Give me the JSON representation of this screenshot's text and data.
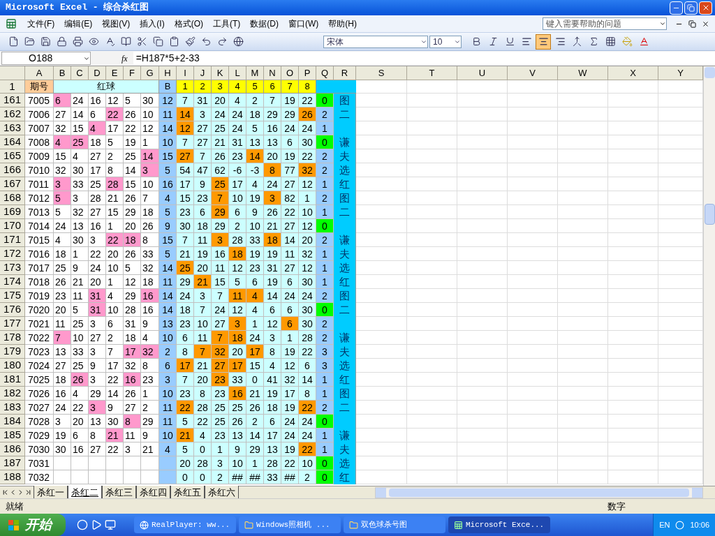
{
  "window": {
    "title": "Microsoft Excel - 综合杀红图"
  },
  "menu": [
    "文件(F)",
    "编辑(E)",
    "视图(V)",
    "插入(I)",
    "格式(O)",
    "工具(T)",
    "数据(D)",
    "窗口(W)",
    "帮助(H)"
  ],
  "help_search": {
    "placeholder": "键入需要帮助的问题"
  },
  "format_toolbar": {
    "font": "宋体",
    "size": "10",
    "align_buttons": [
      {
        "kind": "left",
        "selected": false
      },
      {
        "kind": "center",
        "selected": true
      },
      {
        "kind": "right",
        "selected": false
      }
    ]
  },
  "formula_bar": {
    "name_box": "O188",
    "function_label": "fx",
    "formula": "=H187*5+2-33"
  },
  "columns": [
    "A",
    "B",
    "C",
    "D",
    "E",
    "F",
    "G",
    "H",
    "I",
    "J",
    "K",
    "L",
    "M",
    "N",
    "O",
    "P",
    "Q",
    "R",
    "S",
    "T",
    "U",
    "V",
    "W",
    "X",
    "Y"
  ],
  "header_row": {
    "number": "1",
    "period": "期号",
    "red": "红球",
    "blue": "B",
    "positions": [
      "1",
      "2",
      "3",
      "4",
      "5",
      "6",
      "7",
      "8"
    ]
  },
  "rows": [
    {
      "n": "161",
      "id": "7005",
      "reds": [
        {
          "v": "6",
          "hl": true
        },
        {
          "v": "24",
          "hl": false
        },
        {
          "v": "16",
          "hl": false
        },
        {
          "v": "12",
          "hl": false
        },
        {
          "v": "5",
          "hl": false
        },
        {
          "v": "30",
          "hl": false
        }
      ],
      "blue": "12",
      "kills": [
        {
          "v": "7",
          "hl": false
        },
        {
          "v": "31",
          "hl": false
        },
        {
          "v": "20",
          "hl": false
        },
        {
          "v": "4",
          "hl": false
        },
        {
          "v": "2",
          "hl": false
        },
        {
          "v": "7",
          "hl": false
        },
        {
          "v": "19",
          "hl": false
        },
        {
          "v": "22",
          "hl": false
        }
      ],
      "q": {
        "v": "0",
        "green": true
      },
      "r": "图"
    },
    {
      "n": "162",
      "id": "7006",
      "reds": [
        {
          "v": "27",
          "hl": false
        },
        {
          "v": "14",
          "hl": false
        },
        {
          "v": "6",
          "hl": false
        },
        {
          "v": "22",
          "hl": true
        },
        {
          "v": "26",
          "hl": false
        },
        {
          "v": "10",
          "hl": false
        }
      ],
      "blue": "11",
      "kills": [
        {
          "v": "14",
          "hl": true
        },
        {
          "v": "3",
          "hl": false
        },
        {
          "v": "24",
          "hl": false
        },
        {
          "v": "24",
          "hl": false
        },
        {
          "v": "18",
          "hl": false
        },
        {
          "v": "29",
          "hl": false
        },
        {
          "v": "29",
          "hl": false
        },
        {
          "v": "26",
          "hl": true
        }
      ],
      "q": {
        "v": "2",
        "green": false
      },
      "r": "二"
    },
    {
      "n": "163",
      "id": "7007",
      "reds": [
        {
          "v": "32",
          "hl": false
        },
        {
          "v": "15",
          "hl": false
        },
        {
          "v": "4",
          "hl": true
        },
        {
          "v": "17",
          "hl": false
        },
        {
          "v": "22",
          "hl": false
        },
        {
          "v": "12",
          "hl": false
        }
      ],
      "blue": "14",
      "kills": [
        {
          "v": "12",
          "hl": true
        },
        {
          "v": "27",
          "hl": false
        },
        {
          "v": "25",
          "hl": false
        },
        {
          "v": "24",
          "hl": false
        },
        {
          "v": "5",
          "hl": false
        },
        {
          "v": "16",
          "hl": false
        },
        {
          "v": "24",
          "hl": false
        },
        {
          "v": "24",
          "hl": false
        }
      ],
      "q": {
        "v": "1",
        "green": false
      }
    },
    {
      "n": "164",
      "id": "7008",
      "reds": [
        {
          "v": "4",
          "hl": true
        },
        {
          "v": "25",
          "hl": true
        },
        {
          "v": "18",
          "hl": false
        },
        {
          "v": "5",
          "hl": false
        },
        {
          "v": "19",
          "hl": false
        },
        {
          "v": "1",
          "hl": false
        }
      ],
      "blue": "10",
      "kills": [
        {
          "v": "7",
          "hl": false
        },
        {
          "v": "27",
          "hl": false
        },
        {
          "v": "21",
          "hl": false
        },
        {
          "v": "31",
          "hl": false
        },
        {
          "v": "13",
          "hl": false
        },
        {
          "v": "13",
          "hl": false
        },
        {
          "v": "6",
          "hl": false
        },
        {
          "v": "30",
          "hl": false
        }
      ],
      "q": {
        "v": "0",
        "green": true
      },
      "r": "谦"
    },
    {
      "n": "165",
      "id": "7009",
      "reds": [
        {
          "v": "15",
          "hl": false
        },
        {
          "v": "4",
          "hl": false
        },
        {
          "v": "27",
          "hl": false
        },
        {
          "v": "2",
          "hl": false
        },
        {
          "v": "25",
          "hl": false
        },
        {
          "v": "14",
          "hl": true
        }
      ],
      "blue": "15",
      "kills": [
        {
          "v": "27",
          "hl": true
        },
        {
          "v": "7",
          "hl": false
        },
        {
          "v": "26",
          "hl": false
        },
        {
          "v": "23",
          "hl": false
        },
        {
          "v": "14",
          "hl": true
        },
        {
          "v": "20",
          "hl": false
        },
        {
          "v": "19",
          "hl": false
        },
        {
          "v": "22",
          "hl": false
        }
      ],
      "q": {
        "v": "2",
        "green": false
      },
      "r": "夫"
    },
    {
      "n": "166",
      "id": "7010",
      "reds": [
        {
          "v": "32",
          "hl": false
        },
        {
          "v": "30",
          "hl": false
        },
        {
          "v": "17",
          "hl": false
        },
        {
          "v": "8",
          "hl": false
        },
        {
          "v": "14",
          "hl": false
        },
        {
          "v": "3",
          "hl": true
        }
      ],
      "blue": "5",
      "kills": [
        {
          "v": "54",
          "hl": false
        },
        {
          "v": "47",
          "hl": false
        },
        {
          "v": "62",
          "hl": false
        },
        {
          "v": "-6",
          "hl": false
        },
        {
          "v": "-3",
          "hl": false
        },
        {
          "v": "8",
          "hl": true
        },
        {
          "v": "77",
          "hl": false
        },
        {
          "v": "32",
          "hl": true
        }
      ],
      "q": {
        "v": "2",
        "green": false
      },
      "r": "选"
    },
    {
      "n": "167",
      "id": "7011",
      "reds": [
        {
          "v": "3",
          "hl": true
        },
        {
          "v": "33",
          "hl": false
        },
        {
          "v": "25",
          "hl": false
        },
        {
          "v": "28",
          "hl": true
        },
        {
          "v": "15",
          "hl": false
        },
        {
          "v": "10",
          "hl": false
        }
      ],
      "blue": "16",
      "kills": [
        {
          "v": "17",
          "hl": false
        },
        {
          "v": "9",
          "hl": false
        },
        {
          "v": "25",
          "hl": true
        },
        {
          "v": "17",
          "hl": false
        },
        {
          "v": "4",
          "hl": false
        },
        {
          "v": "24",
          "hl": false
        },
        {
          "v": "27",
          "hl": false
        },
        {
          "v": "12",
          "hl": false
        }
      ],
      "q": {
        "v": "1",
        "green": false
      },
      "r": "红"
    },
    {
      "n": "168",
      "id": "7012",
      "reds": [
        {
          "v": "5",
          "hl": true
        },
        {
          "v": "3",
          "hl": false
        },
        {
          "v": "28",
          "hl": false
        },
        {
          "v": "21",
          "hl": false
        },
        {
          "v": "26",
          "hl": false
        },
        {
          "v": "7",
          "hl": false
        }
      ],
      "blue": "4",
      "kills": [
        {
          "v": "15",
          "hl": false
        },
        {
          "v": "23",
          "hl": false
        },
        {
          "v": "7",
          "hl": true
        },
        {
          "v": "10",
          "hl": false
        },
        {
          "v": "19",
          "hl": false
        },
        {
          "v": "3",
          "hl": true
        },
        {
          "v": "82",
          "hl": false
        },
        {
          "v": "1",
          "hl": false
        }
      ],
      "q": {
        "v": "2",
        "green": false
      },
      "r": "图"
    },
    {
      "n": "169",
      "id": "7013",
      "reds": [
        {
          "v": "5",
          "hl": false
        },
        {
          "v": "32",
          "hl": false
        },
        {
          "v": "27",
          "hl": false
        },
        {
          "v": "15",
          "hl": false
        },
        {
          "v": "29",
          "hl": false
        },
        {
          "v": "18",
          "hl": false
        }
      ],
      "blue": "5",
      "kills": [
        {
          "v": "23",
          "hl": false
        },
        {
          "v": "6",
          "hl": false
        },
        {
          "v": "29",
          "hl": true
        },
        {
          "v": "6",
          "hl": false
        },
        {
          "v": "9",
          "hl": false
        },
        {
          "v": "26",
          "hl": false
        },
        {
          "v": "22",
          "hl": false
        },
        {
          "v": "10",
          "hl": false
        }
      ],
      "q": {
        "v": "1",
        "green": false
      },
      "r": "二"
    },
    {
      "n": "170",
      "id": "7014",
      "reds": [
        {
          "v": "24",
          "hl": false
        },
        {
          "v": "13",
          "hl": false
        },
        {
          "v": "16",
          "hl": false
        },
        {
          "v": "1",
          "hl": false
        },
        {
          "v": "20",
          "hl": false
        },
        {
          "v": "26",
          "hl": false
        }
      ],
      "blue": "9",
      "kills": [
        {
          "v": "30",
          "hl": false
        },
        {
          "v": "18",
          "hl": false
        },
        {
          "v": "29",
          "hl": false
        },
        {
          "v": "2",
          "hl": false
        },
        {
          "v": "10",
          "hl": false
        },
        {
          "v": "21",
          "hl": false
        },
        {
          "v": "27",
          "hl": false
        },
        {
          "v": "12",
          "hl": false
        }
      ],
      "q": {
        "v": "0",
        "green": true
      }
    },
    {
      "n": "171",
      "id": "7015",
      "reds": [
        {
          "v": "4",
          "hl": false
        },
        {
          "v": "30",
          "hl": false
        },
        {
          "v": "3",
          "hl": false
        },
        {
          "v": "22",
          "hl": true
        },
        {
          "v": "18",
          "hl": true
        },
        {
          "v": "8",
          "hl": false
        }
      ],
      "blue": "15",
      "kills": [
        {
          "v": "7",
          "hl": false
        },
        {
          "v": "11",
          "hl": false
        },
        {
          "v": "3",
          "hl": true
        },
        {
          "v": "28",
          "hl": false
        },
        {
          "v": "33",
          "hl": false
        },
        {
          "v": "18",
          "hl": true
        },
        {
          "v": "14",
          "hl": false
        },
        {
          "v": "20",
          "hl": false
        }
      ],
      "q": {
        "v": "2",
        "green": false
      },
      "r": "谦"
    },
    {
      "n": "172",
      "id": "7016",
      "reds": [
        {
          "v": "18",
          "hl": false
        },
        {
          "v": "1",
          "hl": false
        },
        {
          "v": "22",
          "hl": false
        },
        {
          "v": "20",
          "hl": false
        },
        {
          "v": "26",
          "hl": false
        },
        {
          "v": "33",
          "hl": false
        }
      ],
      "blue": "5",
      "kills": [
        {
          "v": "21",
          "hl": false
        },
        {
          "v": "19",
          "hl": false
        },
        {
          "v": "16",
          "hl": false
        },
        {
          "v": "18",
          "hl": true
        },
        {
          "v": "19",
          "hl": false
        },
        {
          "v": "19",
          "hl": false
        },
        {
          "v": "11",
          "hl": false
        },
        {
          "v": "32",
          "hl": false
        }
      ],
      "q": {
        "v": "1",
        "green": false
      },
      "r": "夫"
    },
    {
      "n": "173",
      "id": "7017",
      "reds": [
        {
          "v": "25",
          "hl": false
        },
        {
          "v": "9",
          "hl": false
        },
        {
          "v": "24",
          "hl": false
        },
        {
          "v": "10",
          "hl": false
        },
        {
          "v": "5",
          "hl": false
        },
        {
          "v": "32",
          "hl": false
        }
      ],
      "blue": "14",
      "kills": [
        {
          "v": "25",
          "hl": true
        },
        {
          "v": "20",
          "hl": false
        },
        {
          "v": "11",
          "hl": false
        },
        {
          "v": "12",
          "hl": false
        },
        {
          "v": "23",
          "hl": false
        },
        {
          "v": "31",
          "hl": false
        },
        {
          "v": "27",
          "hl": false
        },
        {
          "v": "12",
          "hl": false
        }
      ],
      "q": {
        "v": "1",
        "green": false
      },
      "r": "选"
    },
    {
      "n": "174",
      "id": "7018",
      "reds": [
        {
          "v": "26",
          "hl": false
        },
        {
          "v": "21",
          "hl": false
        },
        {
          "v": "20",
          "hl": false
        },
        {
          "v": "1",
          "hl": false
        },
        {
          "v": "12",
          "hl": false
        },
        {
          "v": "18",
          "hl": false
        }
      ],
      "blue": "11",
      "kills": [
        {
          "v": "29",
          "hl": false
        },
        {
          "v": "21",
          "hl": true
        },
        {
          "v": "15",
          "hl": false
        },
        {
          "v": "5",
          "hl": false
        },
        {
          "v": "6",
          "hl": false
        },
        {
          "v": "19",
          "hl": false
        },
        {
          "v": "6",
          "hl": false
        },
        {
          "v": "30",
          "hl": false
        }
      ],
      "q": {
        "v": "1",
        "green": false
      },
      "r": "红"
    },
    {
      "n": "175",
      "id": "7019",
      "reds": [
        {
          "v": "23",
          "hl": false
        },
        {
          "v": "11",
          "hl": false
        },
        {
          "v": "31",
          "hl": true
        },
        {
          "v": "4",
          "hl": false
        },
        {
          "v": "29",
          "hl": false
        },
        {
          "v": "16",
          "hl": true
        }
      ],
      "blue": "14",
      "kills": [
        {
          "v": "24",
          "hl": false
        },
        {
          "v": "3",
          "hl": false
        },
        {
          "v": "7",
          "hl": false
        },
        {
          "v": "11",
          "hl": true
        },
        {
          "v": "4",
          "hl": true
        },
        {
          "v": "14",
          "hl": false
        },
        {
          "v": "24",
          "hl": false
        },
        {
          "v": "24",
          "hl": false
        }
      ],
      "q": {
        "v": "2",
        "green": false
      },
      "r": "图"
    },
    {
      "n": "176",
      "id": "7020",
      "reds": [
        {
          "v": "20",
          "hl": false
        },
        {
          "v": "5",
          "hl": false
        },
        {
          "v": "31",
          "hl": true
        },
        {
          "v": "10",
          "hl": false
        },
        {
          "v": "28",
          "hl": false
        },
        {
          "v": "16",
          "hl": false
        }
      ],
      "blue": "14",
      "kills": [
        {
          "v": "18",
          "hl": false
        },
        {
          "v": "7",
          "hl": false
        },
        {
          "v": "24",
          "hl": false
        },
        {
          "v": "12",
          "hl": false
        },
        {
          "v": "4",
          "hl": false
        },
        {
          "v": "6",
          "hl": false
        },
        {
          "v": "6",
          "hl": false
        },
        {
          "v": "30",
          "hl": false
        }
      ],
      "q": {
        "v": "0",
        "green": true
      },
      "r": "二"
    },
    {
      "n": "177",
      "id": "7021",
      "reds": [
        {
          "v": "11",
          "hl": false
        },
        {
          "v": "25",
          "hl": false
        },
        {
          "v": "3",
          "hl": false
        },
        {
          "v": "6",
          "hl": false
        },
        {
          "v": "31",
          "hl": false
        },
        {
          "v": "9",
          "hl": false
        }
      ],
      "blue": "13",
      "kills": [
        {
          "v": "23",
          "hl": false
        },
        {
          "v": "10",
          "hl": false
        },
        {
          "v": "27",
          "hl": false
        },
        {
          "v": "3",
          "hl": true
        },
        {
          "v": "1",
          "hl": false
        },
        {
          "v": "12",
          "hl": false
        },
        {
          "v": "6",
          "hl": true
        },
        {
          "v": "30",
          "hl": false
        }
      ],
      "q": {
        "v": "2",
        "green": false
      }
    },
    {
      "n": "178",
      "id": "7022",
      "reds": [
        {
          "v": "7",
          "hl": true
        },
        {
          "v": "10",
          "hl": false
        },
        {
          "v": "27",
          "hl": false
        },
        {
          "v": "2",
          "hl": false
        },
        {
          "v": "18",
          "hl": false
        },
        {
          "v": "4",
          "hl": false
        }
      ],
      "blue": "10",
      "kills": [
        {
          "v": "6",
          "hl": false
        },
        {
          "v": "11",
          "hl": false
        },
        {
          "v": "7",
          "hl": true
        },
        {
          "v": "18",
          "hl": true
        },
        {
          "v": "24",
          "hl": false
        },
        {
          "v": "3",
          "hl": false
        },
        {
          "v": "1",
          "hl": false
        },
        {
          "v": "28",
          "hl": false
        }
      ],
      "q": {
        "v": "2",
        "green": false
      },
      "r": "谦"
    },
    {
      "n": "179",
      "id": "7023",
      "reds": [
        {
          "v": "13",
          "hl": false
        },
        {
          "v": "33",
          "hl": false
        },
        {
          "v": "3",
          "hl": false
        },
        {
          "v": "7",
          "hl": false
        },
        {
          "v": "17",
          "hl": true
        },
        {
          "v": "32",
          "hl": true
        }
      ],
      "blue": "2",
      "kills": [
        {
          "v": "8",
          "hl": false
        },
        {
          "v": "7",
          "hl": true
        },
        {
          "v": "32",
          "hl": true
        },
        {
          "v": "20",
          "hl": false
        },
        {
          "v": "17",
          "hl": true
        },
        {
          "v": "8",
          "hl": false
        },
        {
          "v": "19",
          "hl": false
        },
        {
          "v": "22",
          "hl": false
        }
      ],
      "q": {
        "v": "3",
        "green": false
      },
      "r": "夫"
    },
    {
      "n": "180",
      "id": "7024",
      "reds": [
        {
          "v": "27",
          "hl": false
        },
        {
          "v": "25",
          "hl": false
        },
        {
          "v": "9",
          "hl": false
        },
        {
          "v": "17",
          "hl": false
        },
        {
          "v": "32",
          "hl": false
        },
        {
          "v": "8",
          "hl": false
        }
      ],
      "blue": "6",
      "kills": [
        {
          "v": "17",
          "hl": true
        },
        {
          "v": "21",
          "hl": false
        },
        {
          "v": "27",
          "hl": true
        },
        {
          "v": "17",
          "hl": true
        },
        {
          "v": "15",
          "hl": false
        },
        {
          "v": "4",
          "hl": false
        },
        {
          "v": "12",
          "hl": false
        },
        {
          "v": "6",
          "hl": false
        }
      ],
      "q": {
        "v": "3",
        "green": false
      },
      "r": "选"
    },
    {
      "n": "181",
      "id": "7025",
      "reds": [
        {
          "v": "18",
          "hl": false
        },
        {
          "v": "26",
          "hl": true
        },
        {
          "v": "3",
          "hl": false
        },
        {
          "v": "22",
          "hl": false
        },
        {
          "v": "16",
          "hl": true
        },
        {
          "v": "23",
          "hl": false
        }
      ],
      "blue": "3",
      "kills": [
        {
          "v": "7",
          "hl": false
        },
        {
          "v": "20",
          "hl": false
        },
        {
          "v": "23",
          "hl": true
        },
        {
          "v": "33",
          "hl": false
        },
        {
          "v": "0",
          "hl": false
        },
        {
          "v": "41",
          "hl": false
        },
        {
          "v": "32",
          "hl": false
        },
        {
          "v": "14",
          "hl": false
        }
      ],
      "q": {
        "v": "1",
        "green": false
      },
      "r": "红"
    },
    {
      "n": "182",
      "id": "7026",
      "reds": [
        {
          "v": "16",
          "hl": false
        },
        {
          "v": "4",
          "hl": false
        },
        {
          "v": "29",
          "hl": false
        },
        {
          "v": "14",
          "hl": false
        },
        {
          "v": "26",
          "hl": false
        },
        {
          "v": "1",
          "hl": false
        }
      ],
      "blue": "10",
      "kills": [
        {
          "v": "23",
          "hl": false
        },
        {
          "v": "8",
          "hl": false
        },
        {
          "v": "23",
          "hl": false
        },
        {
          "v": "16",
          "hl": true
        },
        {
          "v": "21",
          "hl": false
        },
        {
          "v": "19",
          "hl": false
        },
        {
          "v": "17",
          "hl": false
        },
        {
          "v": "8",
          "hl": false
        }
      ],
      "q": {
        "v": "1",
        "green": false
      },
      "r": "图"
    },
    {
      "n": "183",
      "id": "7027",
      "reds": [
        {
          "v": "24",
          "hl": false
        },
        {
          "v": "22",
          "hl": false
        },
        {
          "v": "3",
          "hl": true
        },
        {
          "v": "9",
          "hl": false
        },
        {
          "v": "27",
          "hl": false
        },
        {
          "v": "2",
          "hl": false
        }
      ],
      "blue": "11",
      "kills": [
        {
          "v": "22",
          "hl": true
        },
        {
          "v": "28",
          "hl": false
        },
        {
          "v": "25",
          "hl": false
        },
        {
          "v": "25",
          "hl": false
        },
        {
          "v": "26",
          "hl": false
        },
        {
          "v": "18",
          "hl": false
        },
        {
          "v": "19",
          "hl": false
        },
        {
          "v": "22",
          "hl": true
        }
      ],
      "q": {
        "v": "2",
        "green": false
      },
      "r": "二"
    },
    {
      "n": "184",
      "id": "7028",
      "reds": [
        {
          "v": "3",
          "hl": false
        },
        {
          "v": "20",
          "hl": false
        },
        {
          "v": "13",
          "hl": false
        },
        {
          "v": "30",
          "hl": false
        },
        {
          "v": "8",
          "hl": true
        },
        {
          "v": "29",
          "hl": false
        }
      ],
      "blue": "11",
      "kills": [
        {
          "v": "5",
          "hl": false
        },
        {
          "v": "22",
          "hl": false
        },
        {
          "v": "25",
          "hl": false
        },
        {
          "v": "26",
          "hl": false
        },
        {
          "v": "2",
          "hl": false
        },
        {
          "v": "6",
          "hl": false
        },
        {
          "v": "24",
          "hl": false
        },
        {
          "v": "24",
          "hl": false
        }
      ],
      "q": {
        "v": "0",
        "green": true
      }
    },
    {
      "n": "185",
      "id": "7029",
      "reds": [
        {
          "v": "19",
          "hl": false
        },
        {
          "v": "6",
          "hl": false
        },
        {
          "v": "8",
          "hl": false
        },
        {
          "v": "21",
          "hl": true
        },
        {
          "v": "11",
          "hl": false
        },
        {
          "v": "9",
          "hl": false
        }
      ],
      "blue": "10",
      "kills": [
        {
          "v": "21",
          "hl": true
        },
        {
          "v": "4",
          "hl": false
        },
        {
          "v": "23",
          "hl": false
        },
        {
          "v": "13",
          "hl": false
        },
        {
          "v": "14",
          "hl": false
        },
        {
          "v": "17",
          "hl": false
        },
        {
          "v": "24",
          "hl": false
        },
        {
          "v": "24",
          "hl": false
        }
      ],
      "q": {
        "v": "1",
        "green": false
      },
      "r": "谦"
    },
    {
      "n": "186",
      "id": "7030",
      "reds": [
        {
          "v": "30",
          "hl": false
        },
        {
          "v": "16",
          "hl": false
        },
        {
          "v": "27",
          "hl": false
        },
        {
          "v": "22",
          "hl": false
        },
        {
          "v": "3",
          "hl": false
        },
        {
          "v": "21",
          "hl": false
        }
      ],
      "blue": "4",
      "kills": [
        {
          "v": "5",
          "hl": false
        },
        {
          "v": "0",
          "hl": false
        },
        {
          "v": "1",
          "hl": false
        },
        {
          "v": "9",
          "hl": false
        },
        {
          "v": "29",
          "hl": false
        },
        {
          "v": "13",
          "hl": false
        },
        {
          "v": "19",
          "hl": false
        },
        {
          "v": "22",
          "hl": true
        }
      ],
      "q": {
        "v": "1",
        "green": false
      },
      "r": "夫"
    },
    {
      "n": "187",
      "id": "7031",
      "reds": [],
      "kills": [
        {
          "v": "20",
          "hl": false
        },
        {
          "v": "28",
          "hl": false
        },
        {
          "v": "3",
          "hl": false
        },
        {
          "v": "10",
          "hl": false
        },
        {
          "v": "1",
          "hl": false
        },
        {
          "v": "28",
          "hl": false
        },
        {
          "v": "22",
          "hl": false
        },
        {
          "v": "10",
          "hl": false
        }
      ],
      "q": {
        "v": "0",
        "green": true
      },
      "r": "选"
    },
    {
      "n": "188",
      "id": "7032",
      "reds": [],
      "kills": [
        {
          "v": "0",
          "hl": false
        },
        {
          "v": "0",
          "hl": false
        },
        {
          "v": "2",
          "hl": false
        },
        {
          "v": "##",
          "hl": false
        },
        {
          "v": "##",
          "hl": false
        },
        {
          "v": "33",
          "hl": false
        },
        {
          "v": "##",
          "hl": false
        },
        {
          "v": "2",
          "hl": false
        }
      ],
      "q": {
        "v": "0",
        "green": true
      },
      "r": "红"
    }
  ],
  "sheet_tabs": [
    {
      "label": "杀红一",
      "selected": false
    },
    {
      "label": "杀红二",
      "selected": true
    },
    {
      "label": "杀红三",
      "selected": false
    },
    {
      "label": "杀红四",
      "selected": false
    },
    {
      "label": "杀红五",
      "selected": false
    },
    {
      "label": "杀红六",
      "selected": false
    }
  ],
  "status_bar": {
    "left": "就绪",
    "right": "数字"
  },
  "taskbar": {
    "start": "开始",
    "tasks": [
      {
        "label": "RealPlayer: ww...",
        "kind": "app",
        "selected": false
      },
      {
        "label": "Windows照相机 ...",
        "kind": "folder",
        "selected": false
      },
      {
        "label": "双色球杀号图",
        "kind": "folder",
        "selected": false
      },
      {
        "label": "Microsoft Exce...",
        "kind": "excel",
        "selected": true
      }
    ],
    "language": "EN",
    "clock": "10:06"
  }
}
